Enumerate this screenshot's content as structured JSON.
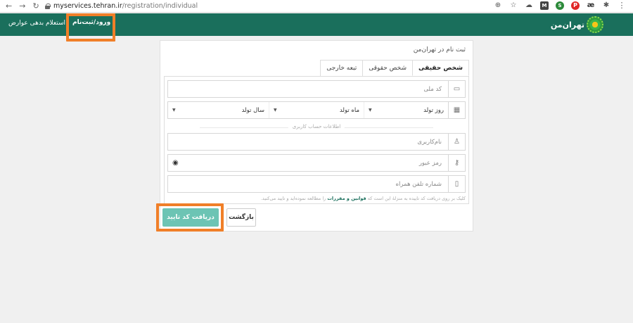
{
  "browser": {
    "url_host": "myservices.tehran.ir",
    "url_path": "/registration/individual"
  },
  "header": {
    "logo_text": "تهران‌من",
    "login_link": "ورود/ثبت‌نام",
    "debt_link": "استعلام بدهی عوارض",
    "bg_color": "#1a6f5c",
    "highlight_color": "#f07f28"
  },
  "card": {
    "title": "ثبت نام در تهران‌من",
    "tabs": [
      {
        "label": "شخص حقیقی",
        "active": true
      },
      {
        "label": "شخص حقوقی",
        "active": false
      },
      {
        "label": "تبعه خارجی",
        "active": false
      }
    ],
    "fields": {
      "national_code_placeholder": "کد ملی",
      "birth_day": "روز تولد",
      "birth_month": "ماه تولد",
      "birth_year": "سال تولد",
      "account_section_label": "اطلاعات حساب کاربری",
      "username_placeholder": "نام‌کاربری",
      "password_placeholder": "رمز عبور",
      "mobile_placeholder": "شماره تلفن همراه"
    },
    "terms_prefix": "کلیک بر روی دریافت کد تاییده به منزلهٔ این است که",
    "terms_link": "قوانین و مقررات",
    "terms_suffix": "را مطالعه نموده‌اید و تایید می‌کنید."
  },
  "buttons": {
    "confirm_label": "دریافت کد تایید",
    "back_label": "بازگشت",
    "confirm_color": "#6cc4b4"
  }
}
